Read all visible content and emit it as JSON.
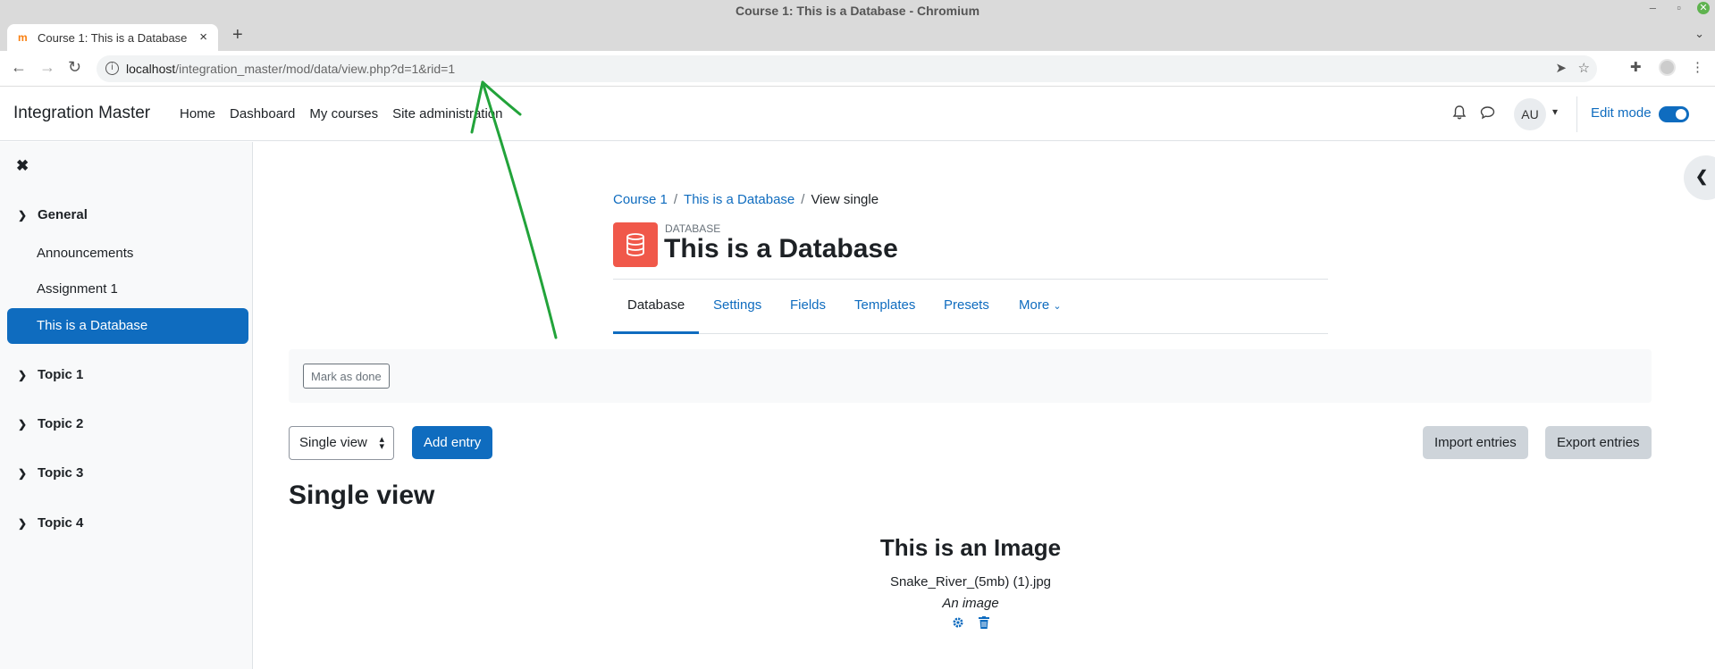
{
  "browser": {
    "window_title": "Course 1: This is a Database - Chromium",
    "tab_title": "Course 1: This is a Database",
    "url_host": "localhost",
    "url_path": "/integration_master/mod/data/view.php?d=1&rid=1"
  },
  "site": {
    "brand": "Integration Master",
    "nav": [
      "Home",
      "Dashboard",
      "My courses",
      "Site administration"
    ],
    "avatar_initials": "AU",
    "edit_mode_label": "Edit mode",
    "edit_mode_on": true
  },
  "drawer": {
    "sections": [
      {
        "label": "General",
        "items": [
          "Announcements",
          "Assignment 1",
          "This is a Database"
        ]
      },
      {
        "label": "Topic 1"
      },
      {
        "label": "Topic 2"
      },
      {
        "label": "Topic 3"
      },
      {
        "label": "Topic 4"
      }
    ],
    "active_item": "This is a Database"
  },
  "header": {
    "breadcrumb": [
      "Course 1",
      "This is a Database",
      "View single"
    ],
    "module_label": "DATABASE",
    "title": "This is a Database",
    "tabs": [
      "Database",
      "Settings",
      "Fields",
      "Templates",
      "Presets",
      "More"
    ],
    "active_tab": "Database"
  },
  "completion": {
    "mark_done_label": "Mark as done"
  },
  "toolbar": {
    "view_select_value": "Single view",
    "add_entry_label": "Add entry",
    "import_label": "Import entries",
    "export_label": "Export entries"
  },
  "content": {
    "heading": "Single view",
    "entry_title": "This is an Image",
    "entry_file": "Snake_River_(5mb) (1).jpg",
    "entry_description": "An image"
  },
  "icons": {
    "edit_entry": "gear-icon",
    "delete_entry": "trash-icon"
  },
  "colors": {
    "primary": "#0f6cbf",
    "db_icon_bg": "#f0584a",
    "annotation": "#22a33a"
  }
}
